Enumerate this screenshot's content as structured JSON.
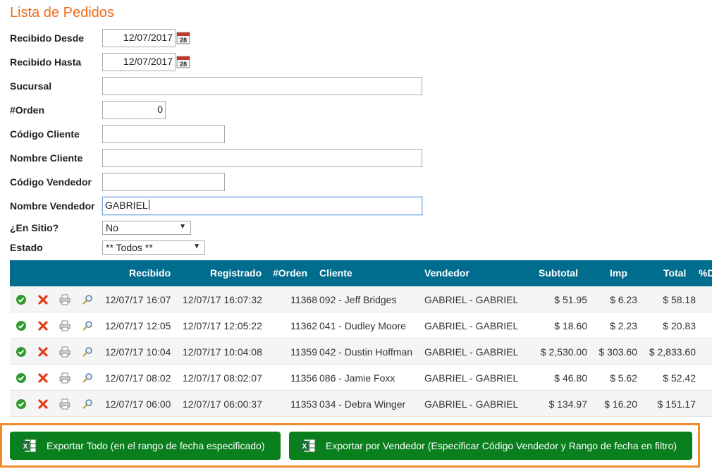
{
  "page": {
    "title": "Lista de Pedidos"
  },
  "filters": {
    "recibido_desde": {
      "label": "Recibido Desde",
      "value": "12/07/2017"
    },
    "recibido_hasta": {
      "label": "Recibido Hasta",
      "value": "12/07/2017"
    },
    "sucursal": {
      "label": "Sucursal",
      "value": ""
    },
    "orden": {
      "label": "#Orden",
      "value": "0"
    },
    "codigo_cliente": {
      "label": "Código Cliente",
      "value": ""
    },
    "nombre_cliente": {
      "label": "Nombre Cliente",
      "value": ""
    },
    "codigo_vendedor": {
      "label": "Código Vendedor",
      "value": ""
    },
    "nombre_vendedor": {
      "label": "Nombre Vendedor",
      "value": "GABRIEL"
    },
    "en_sitio": {
      "label": "¿En Sitio?",
      "value": "No"
    },
    "estado": {
      "label": "Estado",
      "value": "** Todos **"
    }
  },
  "table": {
    "headers": {
      "recibido": "Recibido",
      "registrado": "Registrado",
      "orden": "#Orden",
      "cliente": "Cliente",
      "vendedor": "Vendedor",
      "subtotal": "Subtotal",
      "imp": "Imp",
      "total": "Total",
      "pct": "%D"
    },
    "rows": [
      {
        "recibido": "12/07/17 16:07",
        "registrado": "12/07/17 16:07:32",
        "orden": "11368",
        "cliente": "092 - Jeff Bridges",
        "vendedor": "GABRIEL - GABRIEL",
        "subtotal": "$ 51.95",
        "imp": "$ 6.23",
        "total": "$ 58.18"
      },
      {
        "recibido": "12/07/17 12:05",
        "registrado": "12/07/17 12:05:22",
        "orden": "11362",
        "cliente": "041 - Dudley Moore",
        "vendedor": "GABRIEL - GABRIEL",
        "subtotal": "$ 18.60",
        "imp": "$ 2.23",
        "total": "$ 20.83"
      },
      {
        "recibido": "12/07/17 10:04",
        "registrado": "12/07/17 10:04:08",
        "orden": "11359",
        "cliente": "042 - Dustin Hoffman",
        "vendedor": "GABRIEL - GABRIEL",
        "subtotal": "$ 2,530.00",
        "imp": "$ 303.60",
        "total": "$ 2,833.60"
      },
      {
        "recibido": "12/07/17 08:02",
        "registrado": "12/07/17 08:02:07",
        "orden": "11356",
        "cliente": "086 - Jamie Foxx",
        "vendedor": "GABRIEL - GABRIEL",
        "subtotal": "$ 46.80",
        "imp": "$ 5.62",
        "total": "$ 52.42"
      },
      {
        "recibido": "12/07/17 06:00",
        "registrado": "12/07/17 06:00:37",
        "orden": "11353",
        "cliente": "034 - Debra Winger",
        "vendedor": "GABRIEL - GABRIEL",
        "subtotal": "$ 134.97",
        "imp": "$ 16.20",
        "total": "$ 151.17"
      }
    ],
    "row_icons": [
      "check-icon",
      "delete-icon",
      "print-icon",
      "search-icon"
    ]
  },
  "export": {
    "all_label": "Exportar Todo (en el rango de fecha especificado)",
    "by_vendor_label": "Exportar por Vendedor (Especificar Código Vendedor y Rango de fecha en filtro)",
    "icon": "excel-icon"
  },
  "colors": {
    "title": "#ef6c1a",
    "table_header": "#006c8e",
    "export_button": "#0a7f1e",
    "export_border": "#f28a2c"
  }
}
